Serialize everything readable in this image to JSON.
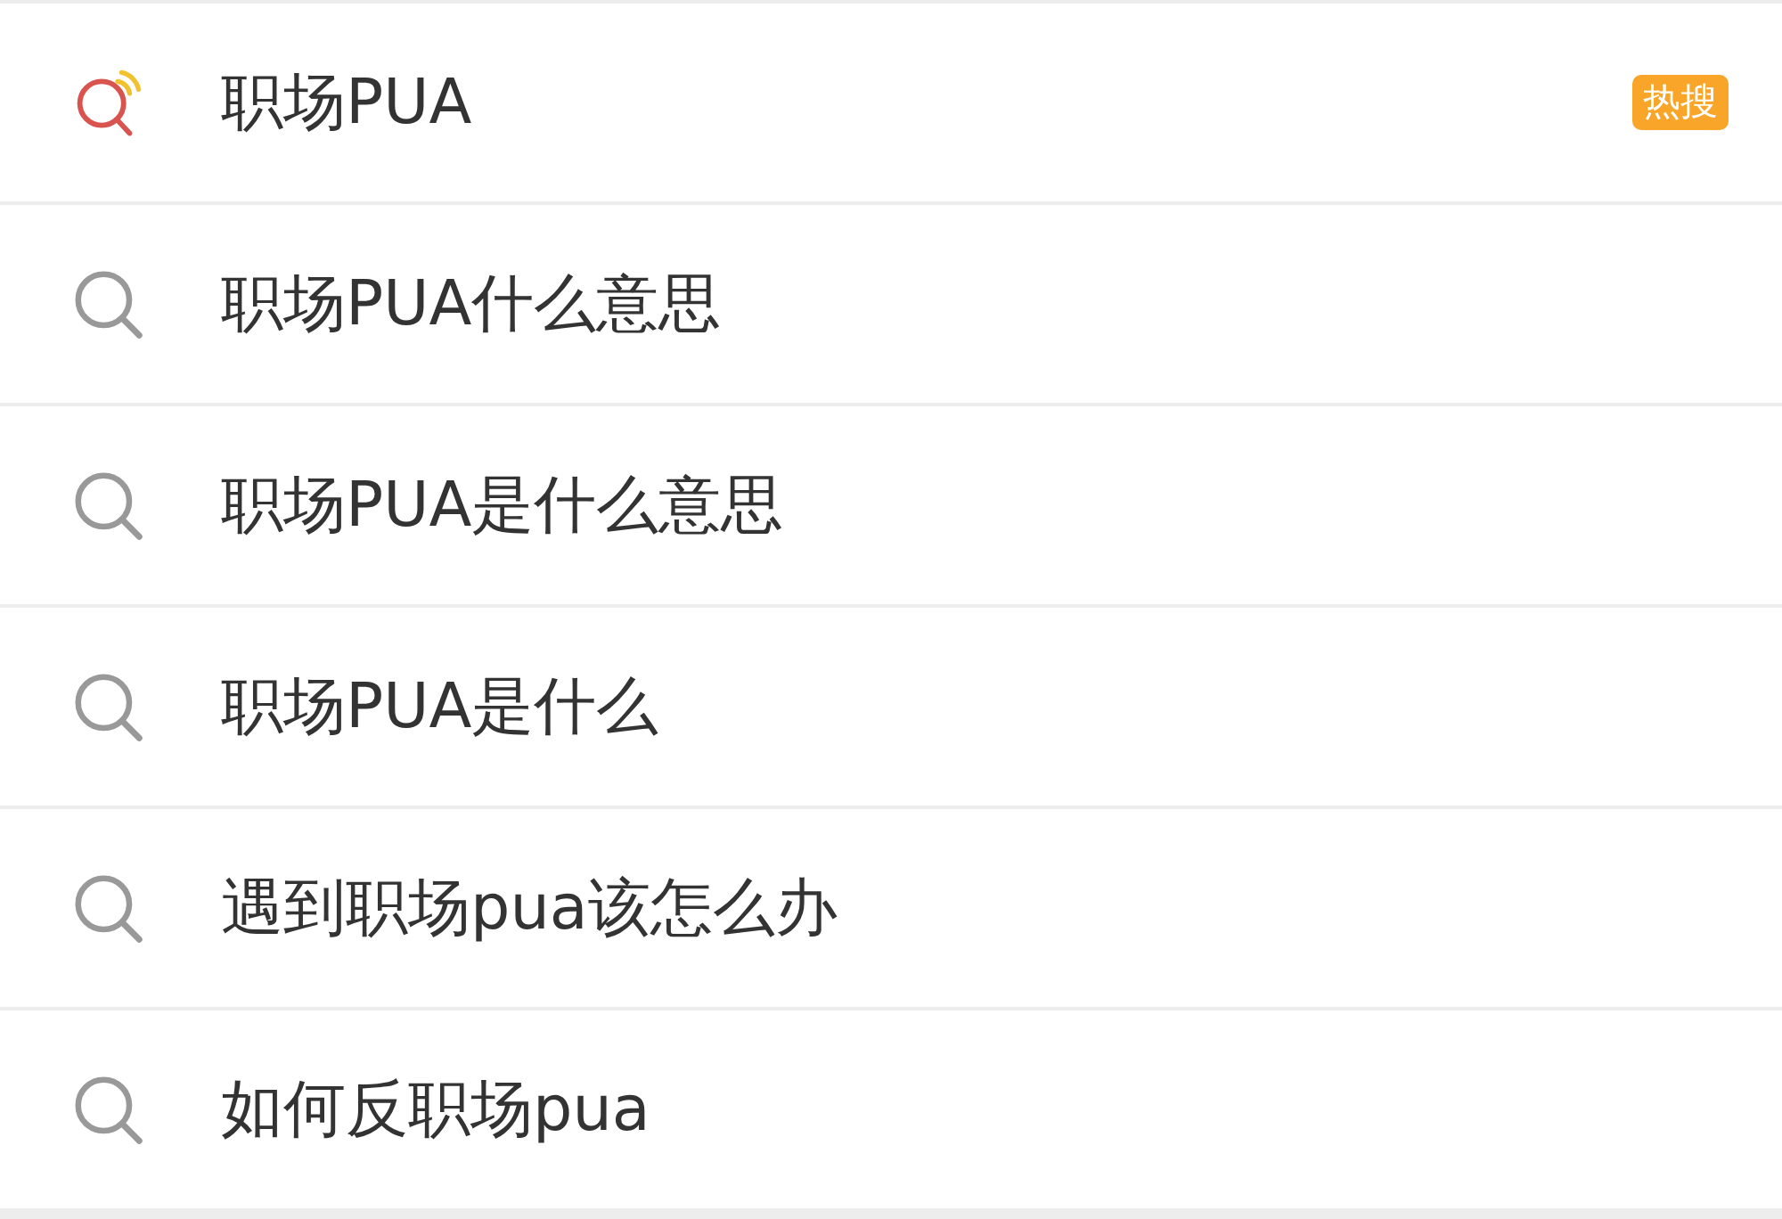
{
  "suggestions": [
    {
      "kind": "trending",
      "text": "职场PUA",
      "badge": "热搜"
    },
    {
      "kind": "search",
      "text": "职场PUA什么意思"
    },
    {
      "kind": "search",
      "text": "职场PUA是什么意思"
    },
    {
      "kind": "search",
      "text": "职场PUA是什么"
    },
    {
      "kind": "search",
      "text": "遇到职场pua该怎么办"
    },
    {
      "kind": "search",
      "text": "如何反职场pua"
    }
  ]
}
